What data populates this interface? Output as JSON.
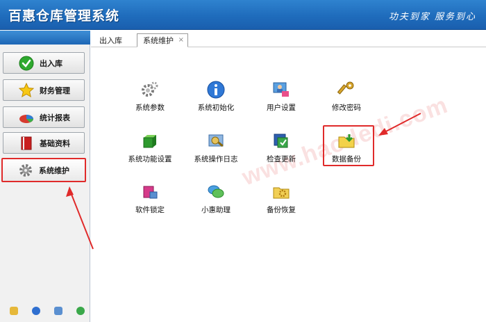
{
  "app": {
    "title": "百惠仓库管理系统",
    "slogan": "功夫到家 服务到心"
  },
  "sidebar": {
    "items": [
      {
        "label": "出入库",
        "icon": "check-circle-icon"
      },
      {
        "label": "财务管理",
        "icon": "star-icon"
      },
      {
        "label": "统计报表",
        "icon": "pie-chart-icon"
      },
      {
        "label": "基础资料",
        "icon": "book-icon"
      },
      {
        "label": "系统维护",
        "icon": "gear-icon",
        "active": true
      }
    ],
    "bottom_icons": [
      "note-icon",
      "clock-icon",
      "monitor-icon",
      "globe-icon"
    ]
  },
  "tabs": [
    {
      "label": "出入库"
    },
    {
      "label": "系统维护",
      "closable": true,
      "close_symbol": "×"
    }
  ],
  "main": {
    "items": [
      {
        "label": "系统参数",
        "icon": "gears-icon"
      },
      {
        "label": "系统初始化",
        "icon": "info-icon"
      },
      {
        "label": "用户设置",
        "icon": "users-icon"
      },
      {
        "label": "修改密码",
        "icon": "key-icon"
      },
      {
        "label": "系统功能设置",
        "icon": "green-box-icon"
      },
      {
        "label": "系统操作日志",
        "icon": "log-icon"
      },
      {
        "label": "检查更新",
        "icon": "update-icon"
      },
      {
        "label": "数据备份",
        "icon": "folder-backup-icon",
        "highlighted": true
      },
      {
        "label": "软件锁定",
        "icon": "lock-icon"
      },
      {
        "label": "小惠助理",
        "icon": "chat-icon"
      },
      {
        "label": "备份恢复",
        "icon": "folder-restore-icon"
      }
    ]
  },
  "watermark": "www.haodedi.com",
  "colors": {
    "header": "#1f6cbc",
    "highlight": "#e02a2a"
  }
}
